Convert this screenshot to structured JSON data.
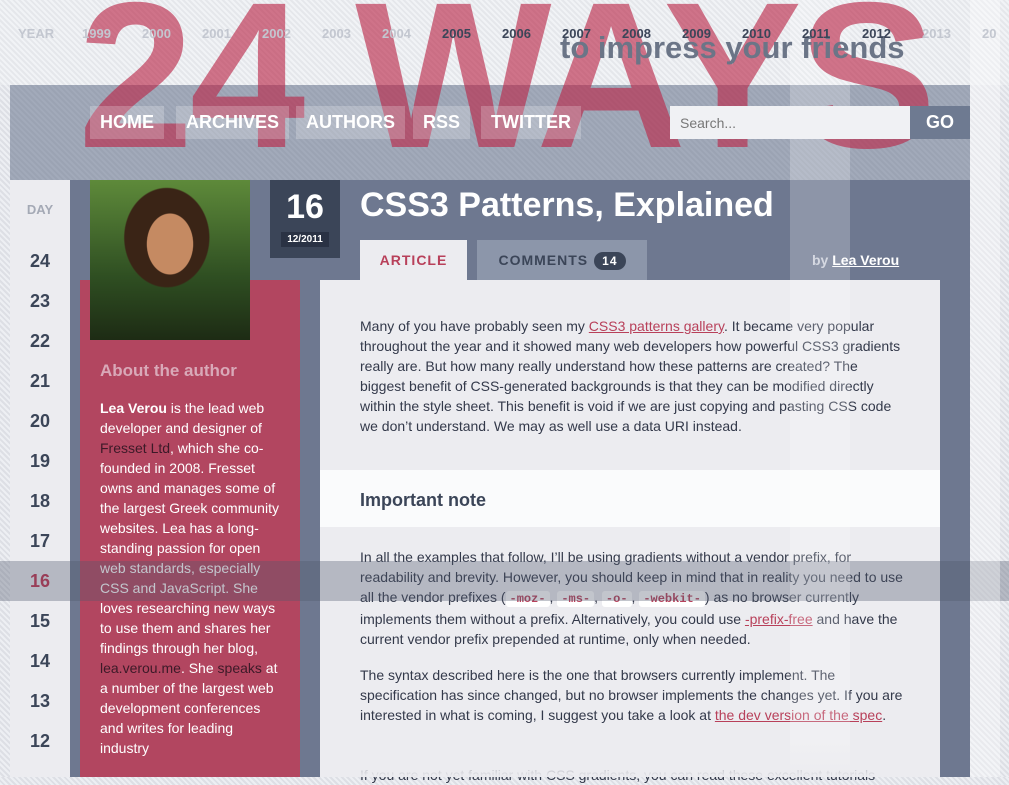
{
  "site": {
    "title": "24 WAYS",
    "tagline": "to impress your friends"
  },
  "years": {
    "label": "YEAR",
    "items": [
      "1999",
      "2000",
      "2001",
      "2002",
      "2003",
      "2004",
      "2005",
      "2006",
      "2007",
      "2008",
      "2009",
      "2010",
      "2011",
      "2012",
      "2013",
      "20"
    ],
    "active": [
      "2005",
      "2006",
      "2007",
      "2008",
      "2009",
      "2010",
      "2011",
      "2012"
    ]
  },
  "nav": {
    "items": [
      "HOME",
      "ARCHIVES",
      "AUTHORS",
      "RSS",
      "TWITTER"
    ],
    "search_placeholder": "Search...",
    "go_label": "GO"
  },
  "days": {
    "label": "DAY",
    "items": [
      "24",
      "23",
      "22",
      "21",
      "20",
      "19",
      "18",
      "17",
      "16",
      "15",
      "14",
      "13",
      "12"
    ],
    "current": "16"
  },
  "article": {
    "date_day": "16",
    "date_month": "12/2011",
    "title": "CSS3 Patterns, Explained",
    "tab_article": "ARTICLE",
    "tab_comments": "COMMENTS",
    "comment_count": "14",
    "by_label": "by",
    "author": "Lea Verou",
    "p1_before": "Many of you have probably seen my ",
    "p1_link": "CSS3 patterns gallery",
    "p1_after": ". It became very popular throughout the year and it showed many web developers how powerful CSS3 gradients really are. But how many really understand how these patterns are created? The biggest benefit of CSS-generated backgrounds is that they can be modified directly within the style sheet. This benefit is void if we are just copying and pasting CSS code we don’t understand. We may as well use a data URI instead.",
    "note_title": "Important note",
    "p2_a": "In all the examples that follow, I’ll be using gradients without a vendor prefix, for readability and brevity. However, you should keep in mind that in reality you need to use all the vendor prefixes (",
    "prefix_moz": "-moz-",
    "prefix_ms": "-ms-",
    "prefix_o": "-o-",
    "prefix_webkit": "-webkit-",
    "p2_b": ") as no browser currently implements them without a prefix. Alternatively, you could use ",
    "p2_link": "-prefix-free",
    "p2_c": " and have the current vendor prefix prepended at runtime, only when needed.",
    "p3_a": "The syntax described here is the one that browsers currently implement. The specification has since changed, but no browser implements the changes yet. If you are interested in what is coming, I suggest you take a look at ",
    "p3_link": "the dev version of the spec",
    "p3_b": ".",
    "p4": "If you are not yet familiar with CSS gradients, you can read these excellent tutorials"
  },
  "about": {
    "title": "About the author",
    "name": "Lea Verou",
    "t1": " is the lead web developer and designer of ",
    "company": "Fresset Ltd",
    "t2": ", which she co-founded in 2008. Fresset owns and manages some of the largest Greek community websites. Lea has a long-standing passion for open web standards, especially CSS and JavaScript. She loves researching new ways to use them and shares her findings through her blog, ",
    "blog": "lea.verou.me",
    "t3": ". She ",
    "speaks": "speaks",
    "t4": " at a number of the largest web development conferences and writes for leading industry"
  }
}
